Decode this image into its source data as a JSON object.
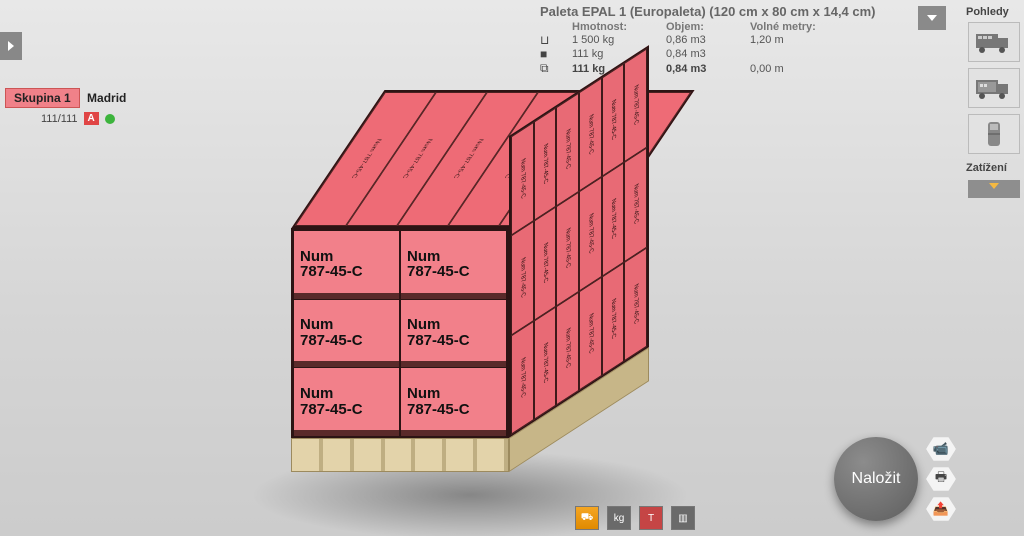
{
  "collapse": {
    "dir": "right"
  },
  "group": {
    "chip": "Skupina 1",
    "city": "Madrid",
    "count": "111/111",
    "badge": "A"
  },
  "info": {
    "title": "Paleta EPAL 1 (Europaleta) (120 cm x 80 cm x 14,4 cm)",
    "headers": {
      "weight": "Hmotnost:",
      "volume": "Objem:",
      "free": "Volné metry:"
    },
    "rows": [
      {
        "icon": "⊔",
        "w": "1 500 kg",
        "v": "0,86 m3",
        "f": "1,20 m"
      },
      {
        "icon": "■",
        "w": "111 kg",
        "v": "0,84 m3",
        "f": ""
      },
      {
        "icon": "⧉",
        "w": "111 kg",
        "v": "0,84 m3",
        "f": "0,00 m",
        "bold": true
      }
    ]
  },
  "sidebar": {
    "views_label": "Pohledy",
    "load_label": "Zatížení"
  },
  "box_label_1": "Num",
  "box_label_2": "787-45-C",
  "box_label_combined": "Num 787-45-C",
  "action_button": "Naložit",
  "bottom_icons": [
    "⛟",
    "kg",
    "T",
    "▥"
  ]
}
